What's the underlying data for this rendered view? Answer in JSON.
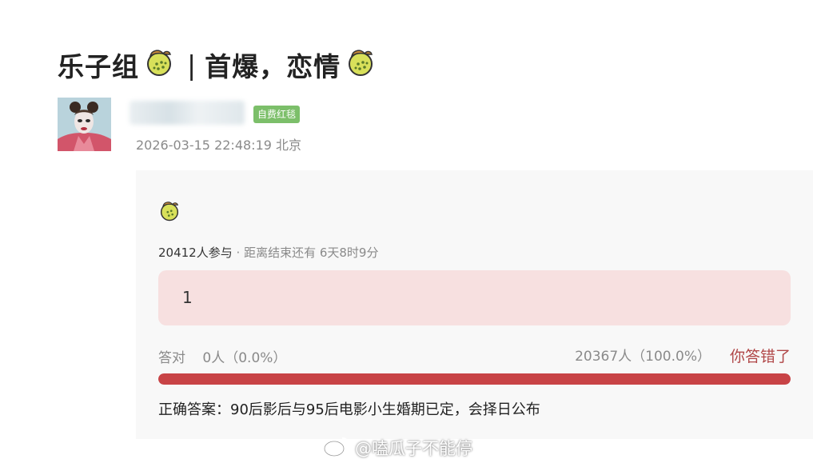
{
  "post": {
    "title_part1": "乐子组",
    "title_separator": "|",
    "title_part2": "首爆，恋情",
    "badge": "自费红毯",
    "timestamp": "2026-03-15 22:48:19",
    "location": "北京"
  },
  "quiz": {
    "participants": "20412人参与",
    "separator": "·",
    "time_remaining": "距离结束还有 6天8时9分",
    "option_label": "1",
    "correct_label": "答对",
    "correct_count": "0人（0.0%）",
    "wrong_count": "20367人（100.0%）",
    "result_status": "你答错了",
    "progress_wrong_fraction": 1.0,
    "answer_text": "正确答案：90后影后与95后电影小生婚期已定，会择日公布"
  },
  "watermark": {
    "text": "@嗑瓜子不能停",
    "icon": "weibo-logo-icon"
  },
  "icons": {
    "title_emoji": "melon-emoji-icon",
    "card_emoji": "melon-emoji-icon"
  },
  "colors": {
    "badge": "#7cbf6a",
    "option_bg": "#f7e0e0",
    "progress": "#c84346",
    "wrong_status": "#b04647"
  }
}
